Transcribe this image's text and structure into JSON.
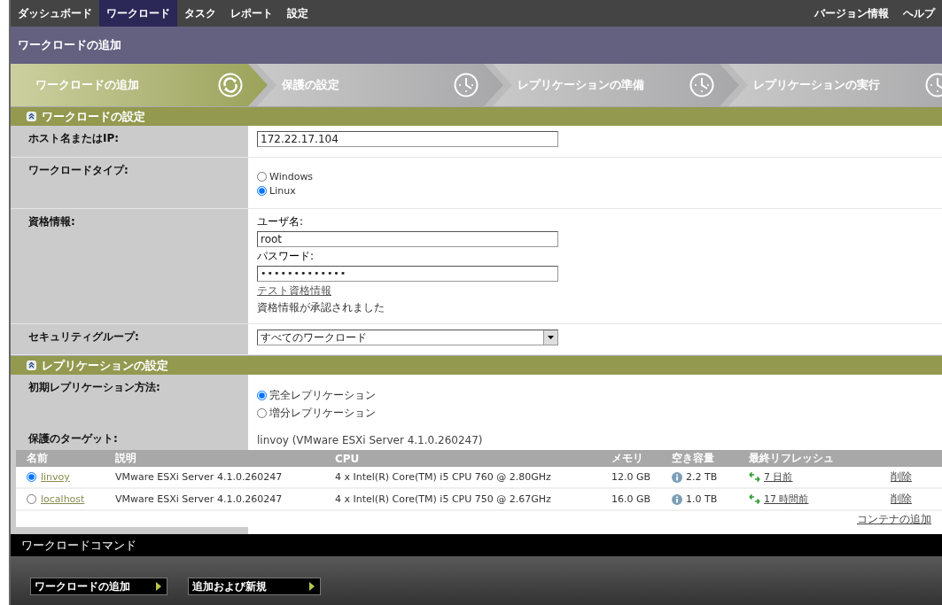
{
  "nav": {
    "items": [
      {
        "label": "ダッシュボード",
        "selected": false
      },
      {
        "label": "ワークロード",
        "selected": true
      },
      {
        "label": "タスク",
        "selected": false
      },
      {
        "label": "レポート",
        "selected": false
      },
      {
        "label": "設定",
        "selected": false
      }
    ],
    "right_items": [
      "バージョン情報",
      "ヘルプ"
    ]
  },
  "page_title": "ワークロードの追加",
  "steps": [
    {
      "label": "ワークロードの追加",
      "selected": true
    },
    {
      "label": "保護の設定",
      "selected": false
    },
    {
      "label": "レプリケーションの準備",
      "selected": false
    },
    {
      "label": "レプリケーションの実行",
      "selected": false
    }
  ],
  "sections": [
    {
      "title": "ワークロードの設定",
      "rows": [
        {
          "kind": "text",
          "label": "ホスト名またはIP:",
          "value": "172.22.17.104"
        },
        {
          "kind": "radio",
          "label": "ワークロードタイプ:",
          "options": [
            {
              "label": "Windows",
              "selected": false
            },
            {
              "label": "Linux",
              "selected": true
            }
          ]
        },
        {
          "kind": "credentials",
          "label": "資格情報:",
          "username_label": "ユーザ名:",
          "username": "root",
          "password_label": "パスワード:",
          "password": "•••••••••••••",
          "test_link": "テスト資格情報",
          "status": "資格情報が承認されました"
        },
        {
          "kind": "select",
          "label": "セキュリティグループ:",
          "value": "すべてのワークロード"
        }
      ]
    },
    {
      "title": "レプリケーションの設定",
      "rows": [
        {
          "kind": "radio",
          "label": "初期レプリケーション方法:",
          "options": [
            {
              "label": "完全レプリケーション",
              "selected": true
            },
            {
              "label": "増分レプリケーション",
              "selected": false
            }
          ]
        },
        {
          "kind": "static",
          "label": "保護のターゲット:",
          "value": "linvoy (VMware ESXi Server 4.1.0.260247)"
        }
      ]
    }
  ],
  "table": {
    "columns": [
      "名前",
      "説明",
      "CPU",
      "メモリ",
      "空き容量",
      "最終リフレッシュ"
    ],
    "rows": [
      {
        "selected": true,
        "name": "linvoy",
        "description": "VMware ESXi Server 4.1.0.260247",
        "cpu": "4 x Intel(R) Core(TM) i5 CPU 760 @ 2.80GHz",
        "memory": "12.0 GB",
        "free_space": "2.2 TB",
        "last_refresh": "7 日前",
        "action": "削除"
      },
      {
        "selected": false,
        "name": "localhost",
        "description": "VMware ESXi Server 4.1.0.260247",
        "cpu": "4 x Intel(R) Core(TM) i5 CPU 750 @ 2.67GHz",
        "memory": "16.0 GB",
        "free_space": "1.0 TB",
        "last_refresh": "17 時間前",
        "action": "削除"
      }
    ],
    "add_link": "コンテナの追加"
  },
  "commands": {
    "title": "ワークロードコマンド",
    "buttons": [
      "ワークロードの追加",
      "追加および新規"
    ]
  }
}
